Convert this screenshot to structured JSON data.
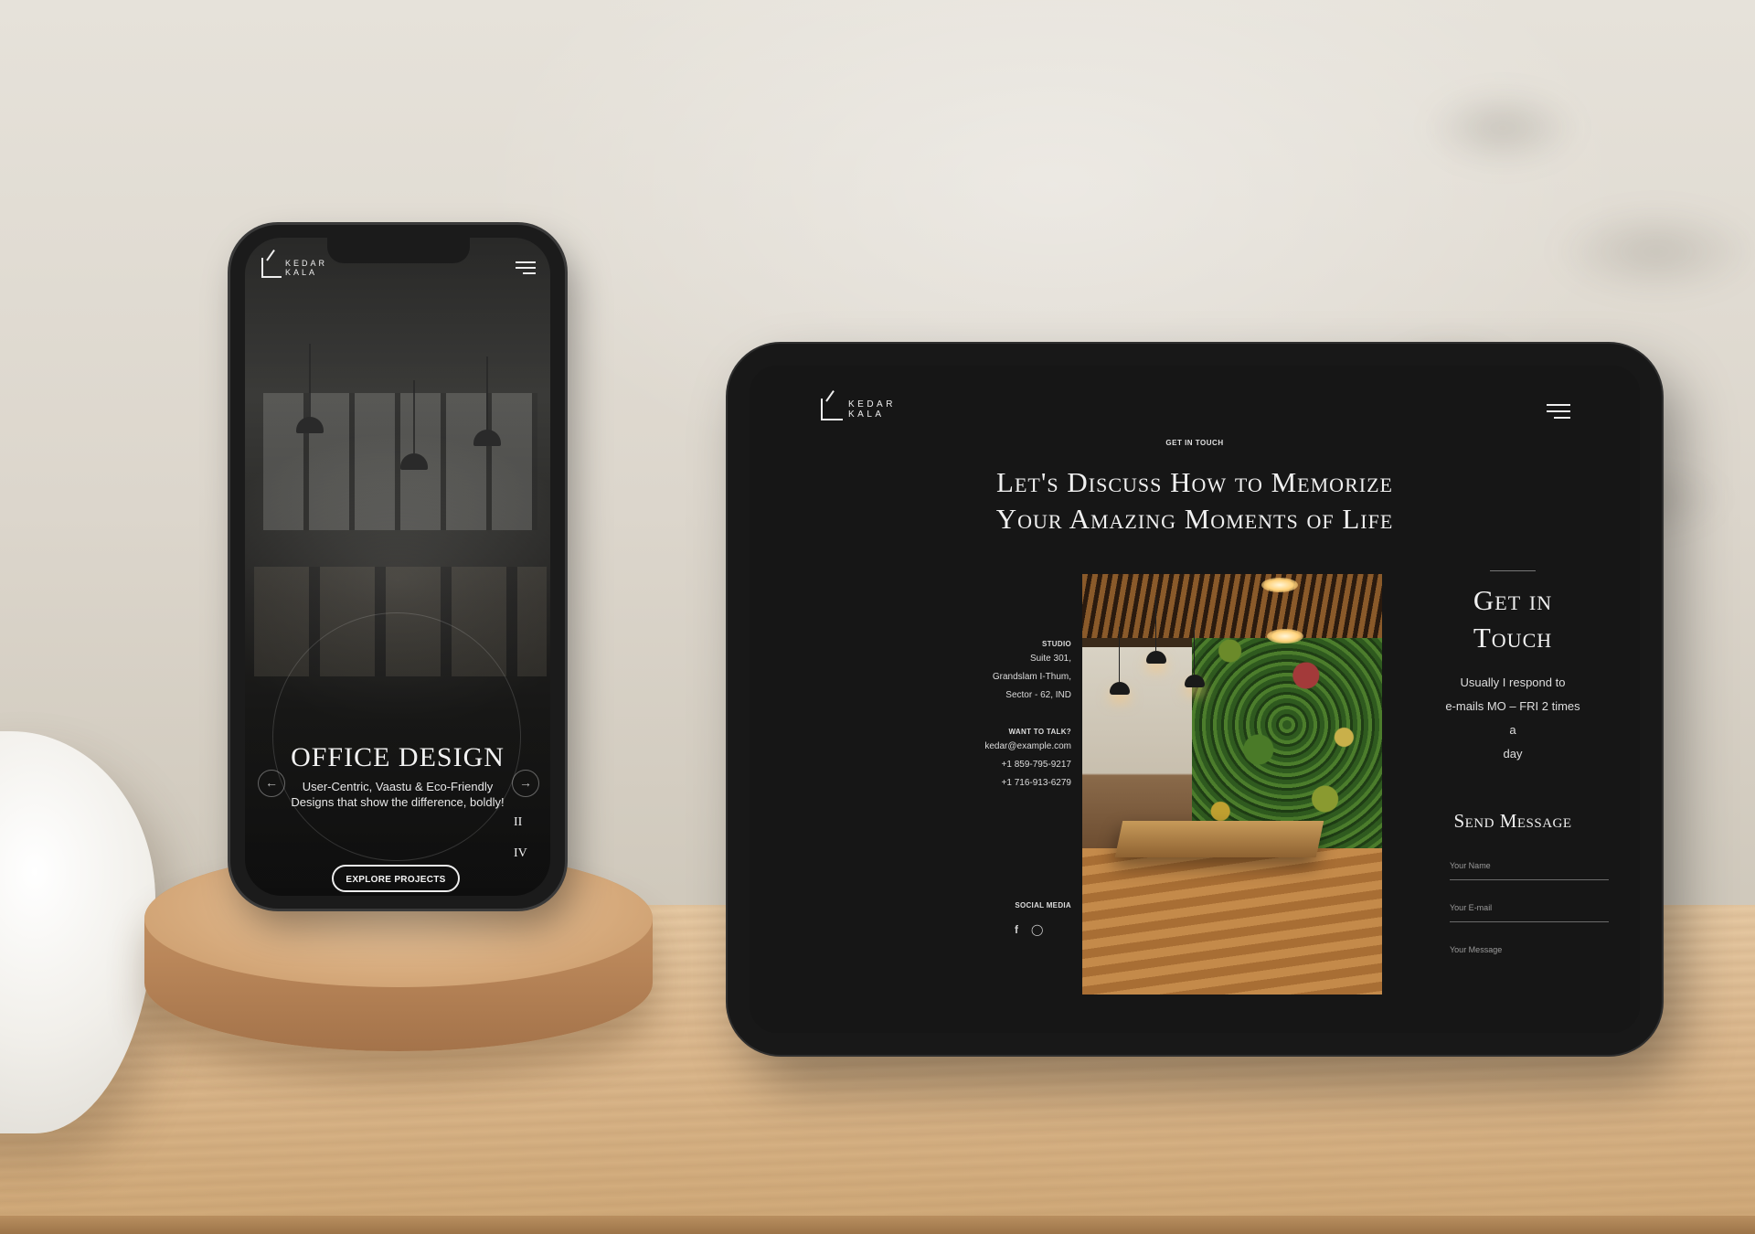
{
  "phone": {
    "logo": {
      "line1": "KEDAR",
      "line2": "KALA"
    },
    "menu_icon": "hamburger-icon",
    "hero": {
      "title": "OFFICE DESIGN",
      "subtitle": "User-Centric, Vaastu & Eco-Friendly Designs that show the difference, boldly!",
      "cta": "EXPLORE PROJECTS",
      "prev_icon": "arrow-left-icon",
      "next_icon": "arrow-right-icon"
    },
    "slide_numbers": [
      "II",
      "IV"
    ]
  },
  "tablet": {
    "logo": {
      "line1": "KEDAR",
      "line2": "KALA"
    },
    "menu_icon": "hamburger-icon",
    "kicker": "GET IN TOUCH",
    "heading_line1": "Let's Discuss How to Memorize",
    "heading_line2": "Your Amazing Moments of Life",
    "studio": {
      "label": "STUDIO",
      "lines": [
        "Suite 301,",
        "Grandslam I-Thum,",
        "Sector - 62, IND"
      ]
    },
    "talk": {
      "label": "WANT TO TALK?",
      "email": "kedar@example.com",
      "phone1": "+1 859-795-9217",
      "phone2": "+1 716-913-6279"
    },
    "social": {
      "label": "SOCIAL MEDIA",
      "icons": [
        "facebook-icon",
        "instagram-icon"
      ]
    },
    "get_in_touch": {
      "title_line1": "Get in",
      "title_line2": "Touch",
      "text_lines": [
        "Usually I respond to",
        "e-mails MO – FRI 2 times",
        "a",
        "day"
      ]
    },
    "form": {
      "title": "Send Message",
      "name_placeholder": "Your Name",
      "email_placeholder": "Your E-mail",
      "message_placeholder": "Your Message"
    }
  },
  "colors": {
    "screen_bg": "#161616",
    "text_light": "#f0f0f0",
    "wood": "#dcb98f"
  }
}
